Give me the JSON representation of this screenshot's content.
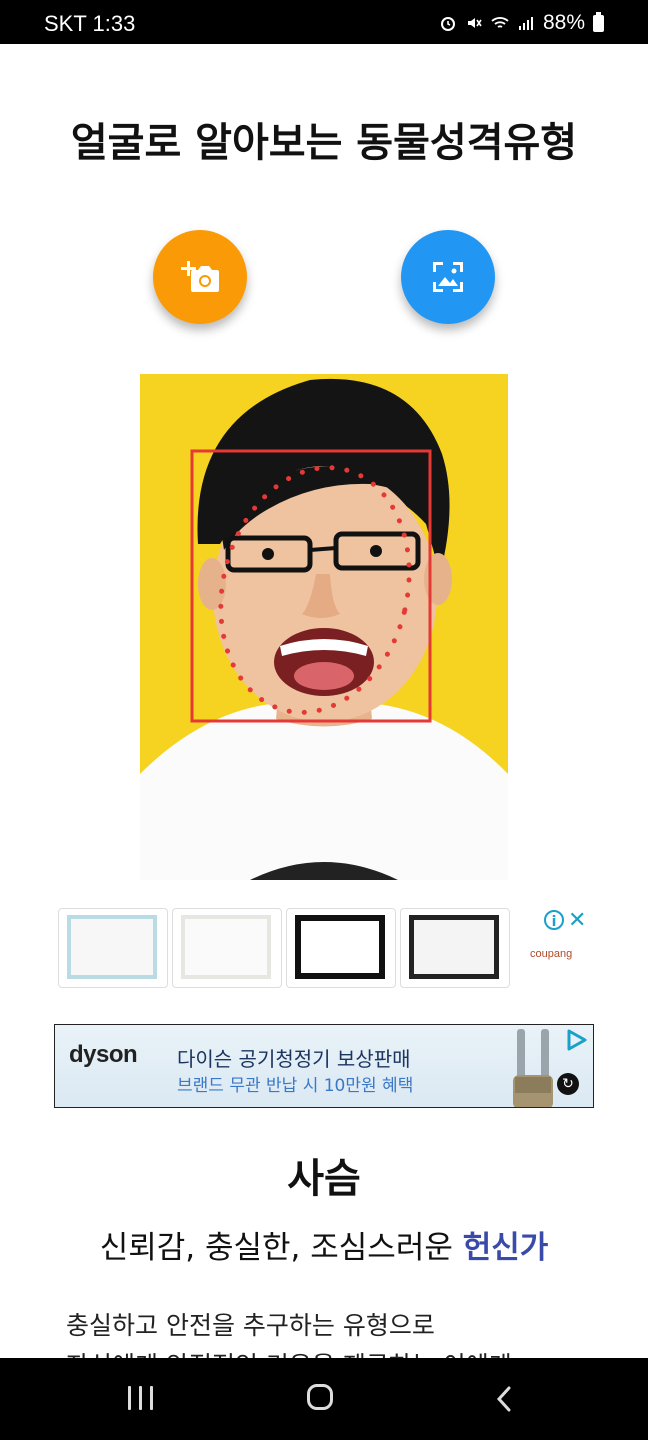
{
  "status_bar": {
    "carrier_time": "SKT 1:33",
    "battery": "88%"
  },
  "title": "얼굴로 알아보는 동물성격유형",
  "buttons": {
    "camera": "add-photo-camera",
    "gallery": "choose-from-gallery"
  },
  "ads": {
    "frames_ad": {
      "brand": "coupang",
      "info_label": "i",
      "close_label": "✕"
    },
    "dyson_ad": {
      "brand": "dyson",
      "headline": "다이슨 공기청정기 보상판매",
      "subline": "브랜드 무관 반납 시 10만원 혜택"
    }
  },
  "result": {
    "animal": "사슴",
    "traits_prefix": "신뢰감, 충실한, 조심스러운 ",
    "traits_highlight": "헌신가",
    "description_line1": "충실하고 안전을 추구하는 유형으로",
    "description_line2": "자신에게 안정적인 기운을 제공하는 이에게"
  },
  "colors": {
    "camera_button": "#fb9a07",
    "gallery_button": "#2196f3",
    "photo_background": "#f5d320",
    "face_box": "#e53935",
    "highlight_text": "#3a4aa8"
  }
}
